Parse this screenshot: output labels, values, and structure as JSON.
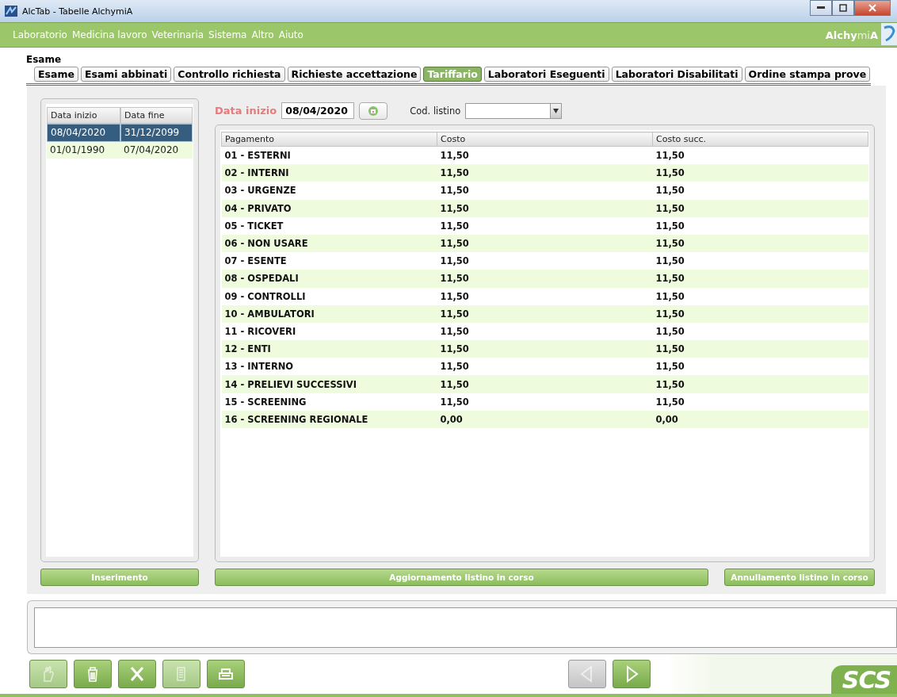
{
  "window": {
    "title": "AlcTab - Tabelle AlchymiA"
  },
  "menu": [
    "Laboratorio",
    "Medicina lavoro",
    "Veterinaria",
    "Sistema",
    "Altro",
    "Aiuto"
  ],
  "brand": "**Alchy**mi**A**",
  "section_title": "Esame",
  "tabs": [
    {
      "label": "Esame",
      "selected": false
    },
    {
      "label": "Esami abbinati",
      "selected": false
    },
    {
      "label": "Controllo richiesta",
      "selected": false
    },
    {
      "label": "Richieste accettazione",
      "selected": false
    },
    {
      "label": "Tariffario",
      "selected": true
    },
    {
      "label": "Laboratori Eseguenti",
      "selected": false
    },
    {
      "label": "Laboratori Disabilitati",
      "selected": false
    },
    {
      "label": "Ordine stampa prove",
      "selected": false
    }
  ],
  "periods": {
    "columns": [
      "Data inizio",
      "Data fine"
    ],
    "rows": [
      {
        "cells": [
          "08/04/2020",
          "31/12/2099"
        ],
        "selected": true
      },
      {
        "cells": [
          "01/01/1990",
          "07/04/2020"
        ],
        "selected": false
      }
    ]
  },
  "filter": {
    "date_label": "Data inizio",
    "date_value": "08/04/2020",
    "listino_label": "Cod. listino"
  },
  "table": {
    "columns": [
      "Pagamento",
      "Costo",
      "Costo succ."
    ],
    "rows": [
      [
        "01 - ESTERNI",
        "11,50",
        "11,50"
      ],
      [
        "02 - INTERNI",
        "11,50",
        "11,50"
      ],
      [
        "03 - URGENZE",
        "11,50",
        "11,50"
      ],
      [
        "04 - PRIVATO",
        "11,50",
        "11,50"
      ],
      [
        "05 - TICKET",
        "11,50",
        "11,50"
      ],
      [
        "06 - NON USARE",
        "11,50",
        "11,50"
      ],
      [
        "07 - ESENTE",
        "11,50",
        "11,50"
      ],
      [
        "08 - OSPEDALI",
        "11,50",
        "11,50"
      ],
      [
        "09 - CONTROLLI",
        "11,50",
        "11,50"
      ],
      [
        "10 - AMBULATORI",
        "11,50",
        "11,50"
      ],
      [
        "11 - RICOVERI",
        "11,50",
        "11,50"
      ],
      [
        "12 - ENTI",
        "11,50",
        "11,50"
      ],
      [
        "13 - INTERNO",
        "11,50",
        "11,50"
      ],
      [
        "14 - PRELIEVI SUCCESSIVI",
        "11,50",
        "11,50"
      ],
      [
        "15 - SCREENING",
        "11,50",
        "11,50"
      ],
      [
        "16 - SCREENING REGIONALE",
        "0,00",
        "0,00"
      ]
    ]
  },
  "actions": [
    "Inserimento",
    "Aggiornamento listino in corso",
    "Annullamento listino in corso"
  ],
  "toolbar": [
    {
      "kind": "ok",
      "disabled": true
    },
    {
      "kind": "delete",
      "disabled": false
    },
    {
      "kind": "cancel",
      "disabled": false
    },
    {
      "kind": "document",
      "disabled": true
    },
    {
      "kind": "print",
      "disabled": false
    }
  ],
  "navigation": [
    {
      "kind": "previous",
      "disabled": true
    },
    {
      "kind": "next",
      "disabled": false
    }
  ],
  "footer_logo": "SCS"
}
